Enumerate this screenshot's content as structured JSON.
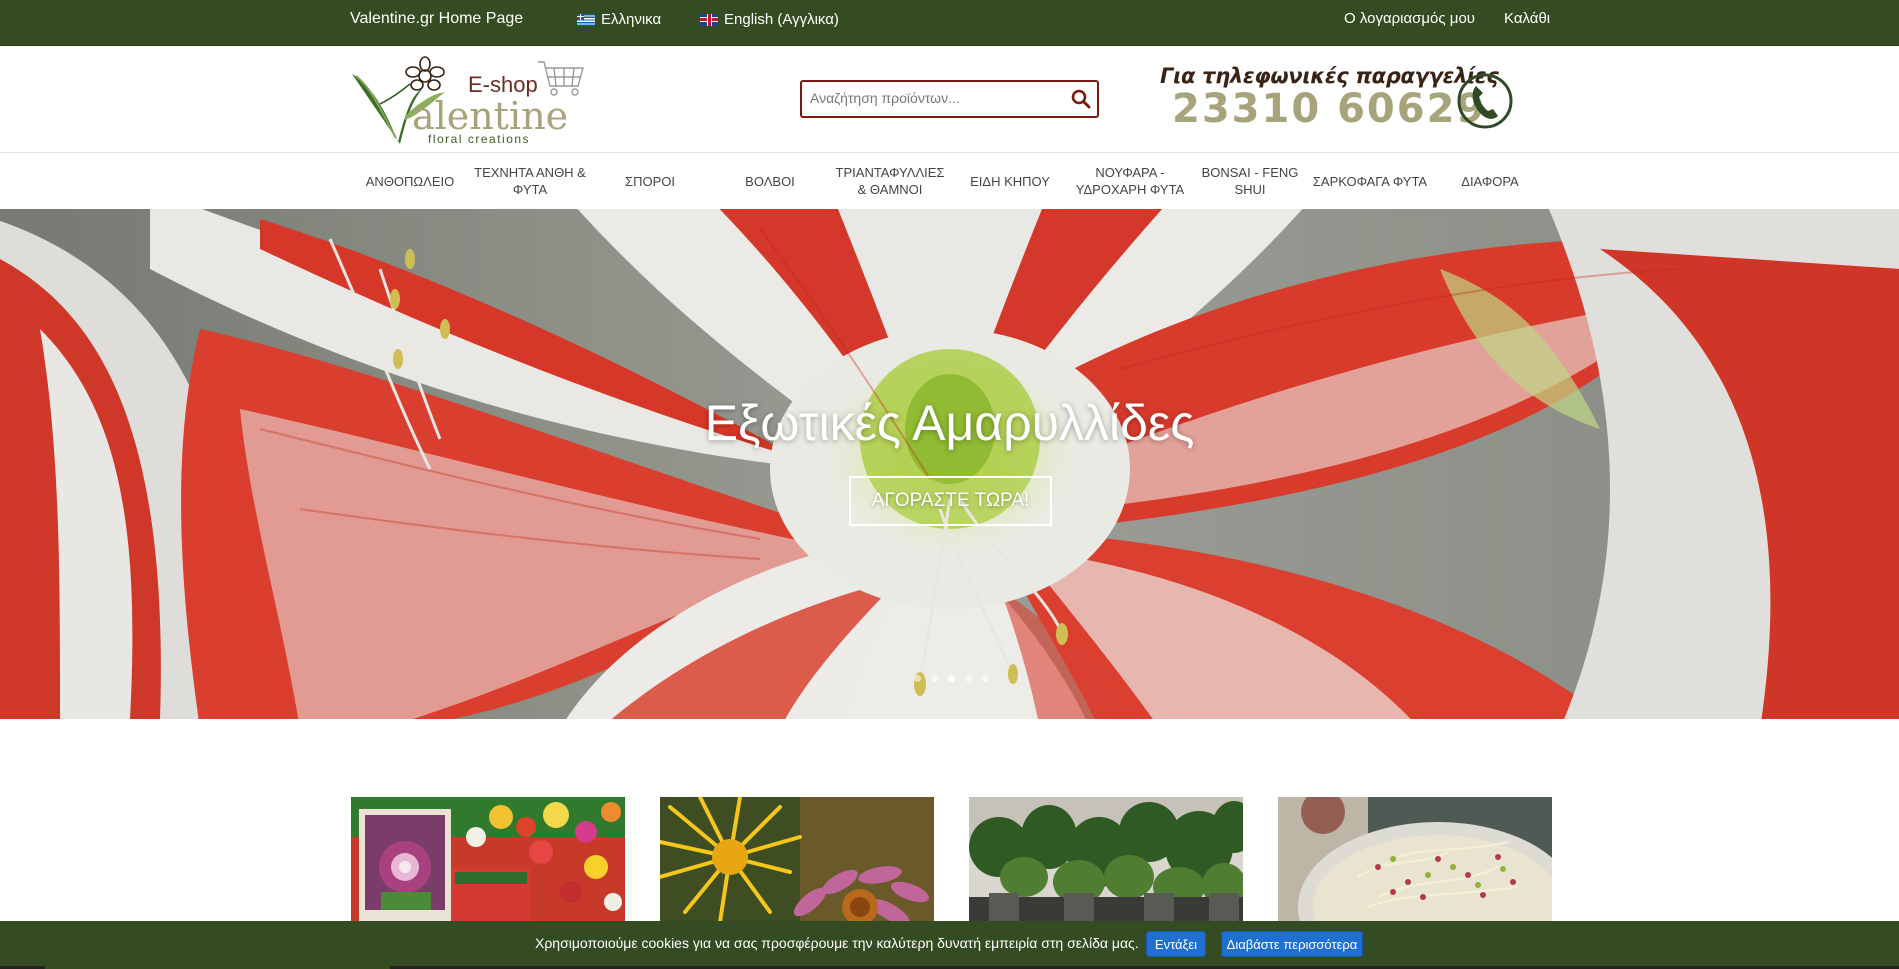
{
  "topbar": {
    "home_link": "Valentine.gr Home Page",
    "lang_greek": "Ελληνικα",
    "lang_english": "English (Αγγλικα)",
    "account": "Ο λογαριασμός μου",
    "cart": "Καλάθι"
  },
  "logo": {
    "eshop": "E-shop",
    "brand": "alentine",
    "tagline": "floral creations"
  },
  "search": {
    "placeholder": "Αναζήτηση προϊόντων..."
  },
  "phone": {
    "caption": "Για τηλεφωνικές παραγγελίες",
    "number": "23310 60629"
  },
  "nav": {
    "items": [
      {
        "label": "ΑΝΘΟΠΩΛΕΙΟ"
      },
      {
        "label": "ΤΕΧΝΗΤΑ ΑΝΘΗ & ΦΥΤΑ"
      },
      {
        "label": "ΣΠΟΡΟΙ"
      },
      {
        "label": "ΒΟΛΒΟΙ"
      },
      {
        "label": "ΤΡΙΑΝΤΑΦΥΛΛΙΕΣ & ΘΑΜΝΟΙ"
      },
      {
        "label": "ΕΙΔΗ ΚΗΠΟΥ"
      },
      {
        "label": "ΝΟΥΦΑΡΑ - ΥΔΡΟΧΑΡΗ ΦΥΤΑ"
      },
      {
        "label": "BONSAI - FENG SHUI"
      },
      {
        "label": "ΣΑΡΚΟΦΑΓΑ ΦΥΤΑ"
      },
      {
        "label": "ΔΙΑΦΟΡΑ"
      }
    ]
  },
  "hero": {
    "title": "Εξωτικές Αμαρυλλίδες",
    "button": "ΑΓΟΡΑΣΤΕ ΤΩΡΑ!",
    "slide_count": 5,
    "active_slide": 3
  },
  "cookie": {
    "message": "Χρησιμοποιούμε cookies για να σας προσφέρουμε την καλύτερη δυνατή εμπειρία στη σελίδα μας.",
    "accept": "Εντάξει",
    "read_more": "Διαβάστε περισσότερα"
  },
  "colors": {
    "topbar_bg": "#354c22",
    "search_border": "#7a1a12",
    "button_blue": "#1f6fd0",
    "phone_number": "#a7a37a"
  }
}
